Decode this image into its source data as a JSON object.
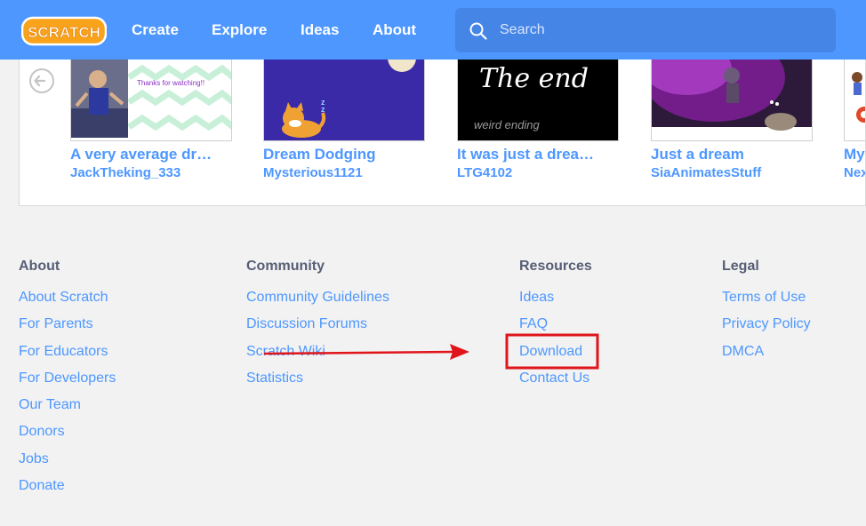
{
  "header": {
    "logo_text": "SCRATCH",
    "nav": [
      "Create",
      "Explore",
      "Ideas",
      "About"
    ],
    "search": {
      "placeholder": "Search",
      "icon": "search-icon"
    }
  },
  "carousel": {
    "projects": [
      {
        "title": "A very average dr…",
        "author": "JackTheking_333",
        "thumb_text": "Thanks for watching!!"
      },
      {
        "title": "Dream Dodging",
        "author": "Mysterious1121",
        "thumb_text": "z z"
      },
      {
        "title": "It was just a drea…",
        "author": "LTG4102",
        "thumb_text": "The end"
      },
      {
        "title": "Just a dream",
        "author": "SiaAnimatesStuff",
        "thumb_text": ""
      },
      {
        "title": "My",
        "author": "Nex",
        "thumb_text": ""
      }
    ],
    "thumb_caption_3": "weird ending"
  },
  "footer": {
    "about": {
      "heading": "About",
      "links": [
        "About Scratch",
        "For Parents",
        "For Educators",
        "For Developers",
        "Our Team",
        "Donors",
        "Jobs",
        "Donate"
      ]
    },
    "community": {
      "heading": "Community",
      "links": [
        "Community Guidelines",
        "Discussion Forums",
        "Scratch Wiki",
        "Statistics"
      ]
    },
    "resources": {
      "heading": "Resources",
      "links": [
        "Ideas",
        "FAQ",
        "Download",
        "Contact Us"
      ]
    },
    "legal": {
      "heading": "Legal",
      "links": [
        "Terms of Use",
        "Privacy Policy",
        "DMCA"
      ]
    }
  },
  "colors": {
    "brand_blue": "#4d97ff",
    "annotation_red": "#e0151b",
    "footer_bg": "#f2f2f2",
    "heading_gray": "#575e75"
  }
}
